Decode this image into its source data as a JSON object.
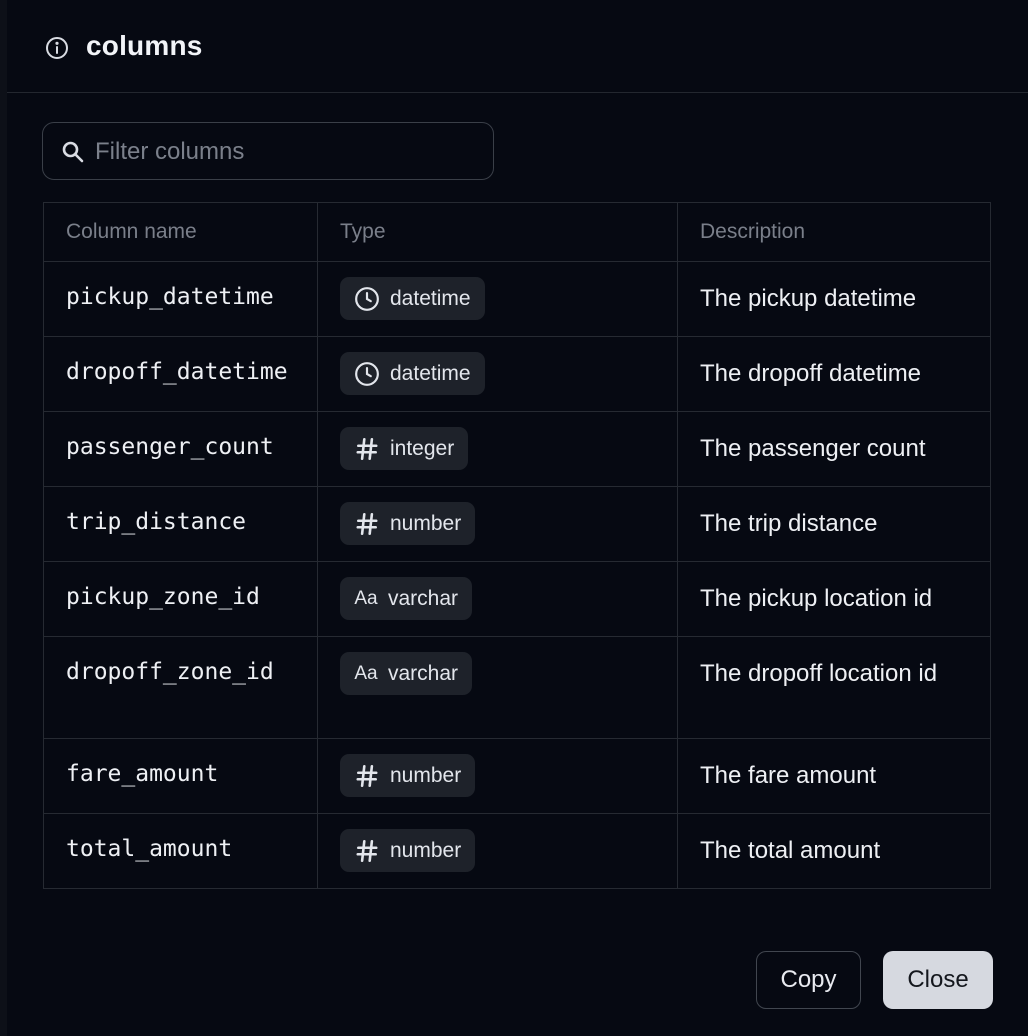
{
  "dialog": {
    "title": "columns",
    "title_icon": "info-circle-icon"
  },
  "search": {
    "placeholder": "Filter columns",
    "value": "",
    "icon": "search-icon"
  },
  "table": {
    "headers": {
      "name": "Column name",
      "type": "Type",
      "description": "Description"
    },
    "rows": [
      {
        "name": "pickup_datetime",
        "type": "datetime",
        "type_icon": "clock-icon",
        "description": "The pickup datetime"
      },
      {
        "name": "dropoff_datetime",
        "type": "datetime",
        "type_icon": "clock-icon",
        "description": "The dropoff datetime"
      },
      {
        "name": "passenger_count",
        "type": "integer",
        "type_icon": "hash-icon",
        "description": "The passenger count"
      },
      {
        "name": "trip_distance",
        "type": "number",
        "type_icon": "hash-icon",
        "description": "The trip distance"
      },
      {
        "name": "pickup_zone_id",
        "type": "varchar",
        "type_icon": "text-aa-icon",
        "description": "The pickup location id"
      },
      {
        "name": "dropoff_zone_id",
        "type": "varchar",
        "type_icon": "text-aa-icon",
        "description": "The dropoff location id"
      },
      {
        "name": "fare_amount",
        "type": "number",
        "type_icon": "hash-icon",
        "description": "The fare amount"
      },
      {
        "name": "total_amount",
        "type": "number",
        "type_icon": "hash-icon",
        "description": "The total amount"
      }
    ]
  },
  "icons": {
    "aa_glyph": "Aa"
  },
  "footer": {
    "copy_label": "Copy",
    "close_label": "Close"
  },
  "colors": {
    "background": "#060912",
    "border": "#262a32",
    "chip_bg": "#1e222a",
    "close_button_bg": "#d6d9e0"
  }
}
